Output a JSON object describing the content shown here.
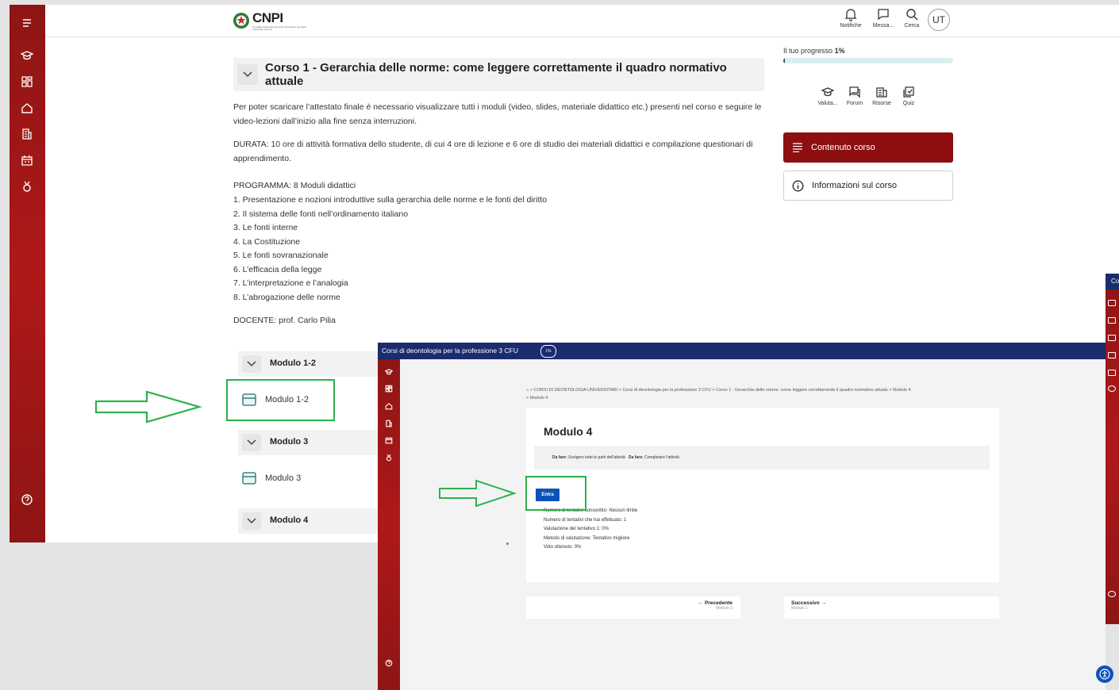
{
  "shot1": {
    "logo": {
      "name": "CNPI",
      "subtitle": "Consiglio Nazionale dei Periti Industriali e dei Periti Industriali Laureati"
    },
    "header": {
      "notifications_label": "Notifiche",
      "messages_label": "Messa...",
      "search_label": "Cerca",
      "avatar_initials": "UT"
    },
    "course": {
      "title": "Corso 1 - Gerarchia delle norme: come leggere correttamente il quadro normativo attuale",
      "paragraph1": "Per poter scaricare l’attestato finale è necessario visualizzare tutti i moduli (video, slides, materiale didattico etc.) presenti nel corso e seguire le video-lezioni dall’inizio alla fine senza interruzioni.",
      "paragraph2": "DURATA: 10 ore di attività formativa dello studente, di cui 4 ore di lezione e 6 ore di studio dei materiali didattici e compilazione questionari di apprendimento.",
      "program_heading": "PROGRAMMA: 8 Moduli didattici",
      "program_items": [
        "1. Presentazione e nozioni introduttive sulla gerarchia delle norme e le fonti del diritto",
        "2. Il sistema delle fonti nell’ordinamento italiano",
        "3. Le fonti interne",
        "4. La Costituzione",
        "5. Le fonti sovranazionale",
        "6. L’efficacia della legge",
        "7. L’interpretazione e l’analogia",
        "8. L’abrogazione delle norme"
      ],
      "teacher": "DOCENTE: prof. Carlo Pilia"
    },
    "modules": [
      {
        "header": "Modulo 1-2",
        "item": "Modulo 1-2"
      },
      {
        "header": "Modulo 3",
        "item": "Modulo 3"
      },
      {
        "header": "Modulo 4"
      }
    ],
    "progress": {
      "label": "Il tuo progresso",
      "value_text": "1%",
      "value": 0.01
    },
    "tools": [
      "Valuta...",
      "Forum",
      "Risorse",
      "Quiz"
    ],
    "buttons": {
      "content": "Contenuto corso",
      "info": "Informazioni sul corso"
    }
  },
  "shot2": {
    "top_title": "Corsi di deontologia per la professione 3 CFU",
    "top_badge": "1%",
    "breadcrumb": [
      "CORSI DI DEONTOLOGIA UNIVERSITARI",
      "Corsi di deontologia per la professione 3 CFU",
      "Corso 1 - Gerarchia delle norme: come leggere correttamente il quadro normativo attuale",
      "Modulo 4",
      "Modulo 4"
    ],
    "module_title": "Modulo 4",
    "todo": [
      {
        "label": "Da fare:",
        "text": "Svolgere tutte le parti dell'attività"
      },
      {
        "label": "Da fare:",
        "text": "Completare l'attività"
      }
    ],
    "enter_button": "Entra",
    "info_lines": [
      "Numero di tentativi consentito: Nessun limite",
      "Numero di tentativi che hai effettuato: 1",
      "Valutazione del tentativo 1: 0%",
      "Metodo di valutazione: Tentativo migliore",
      "Voto ottenuto: 0%"
    ],
    "nav": {
      "prev_label": "← Precedente",
      "prev_sub": "Modulo 3",
      "next_label": "Successivo →",
      "next_sub": "Modulo 1"
    }
  },
  "shot3": {
    "top_text": "Co"
  },
  "colors": {
    "sidebar": "#a11616",
    "primary_button": "#8d0f0f",
    "topbar_blue": "#1a2b6e",
    "annotation_green": "#2bb24c",
    "entra_blue": "#0d52b8"
  }
}
